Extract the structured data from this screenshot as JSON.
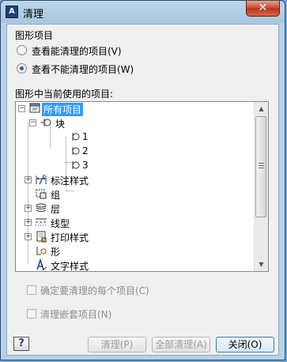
{
  "window": {
    "title": "清理",
    "app_icon_text": "A",
    "close_glyph": "✕"
  },
  "group": {
    "label": "图形项目"
  },
  "radios": [
    {
      "label": "查看能清理的项目(V)",
      "checked": false
    },
    {
      "label": "查看不能清理的项目(W)",
      "checked": true
    }
  ],
  "tree": {
    "label": "图形中当前使用的项目:",
    "root": "所有项目",
    "items": {
      "block": "块",
      "block_children": [
        "1",
        "2",
        "3"
      ],
      "dimstyle": "标注样式",
      "group": "组",
      "layer": "层",
      "linetype": "线型",
      "plotstyle": "打印样式",
      "shape": "形",
      "textstyle": "文字样式"
    }
  },
  "options": {
    "confirm_each": "确定要清理的每个项目(C)",
    "purge_nested": "清理嵌套项目(N)"
  },
  "buttons": {
    "help": "?",
    "purge": "清理(P)",
    "purge_all": "全部清理(A)",
    "close": "关闭(O)"
  },
  "colors": {
    "selection": "#3399ff",
    "title_bar": "#a9c7e0",
    "close_button": "#c7452f"
  }
}
